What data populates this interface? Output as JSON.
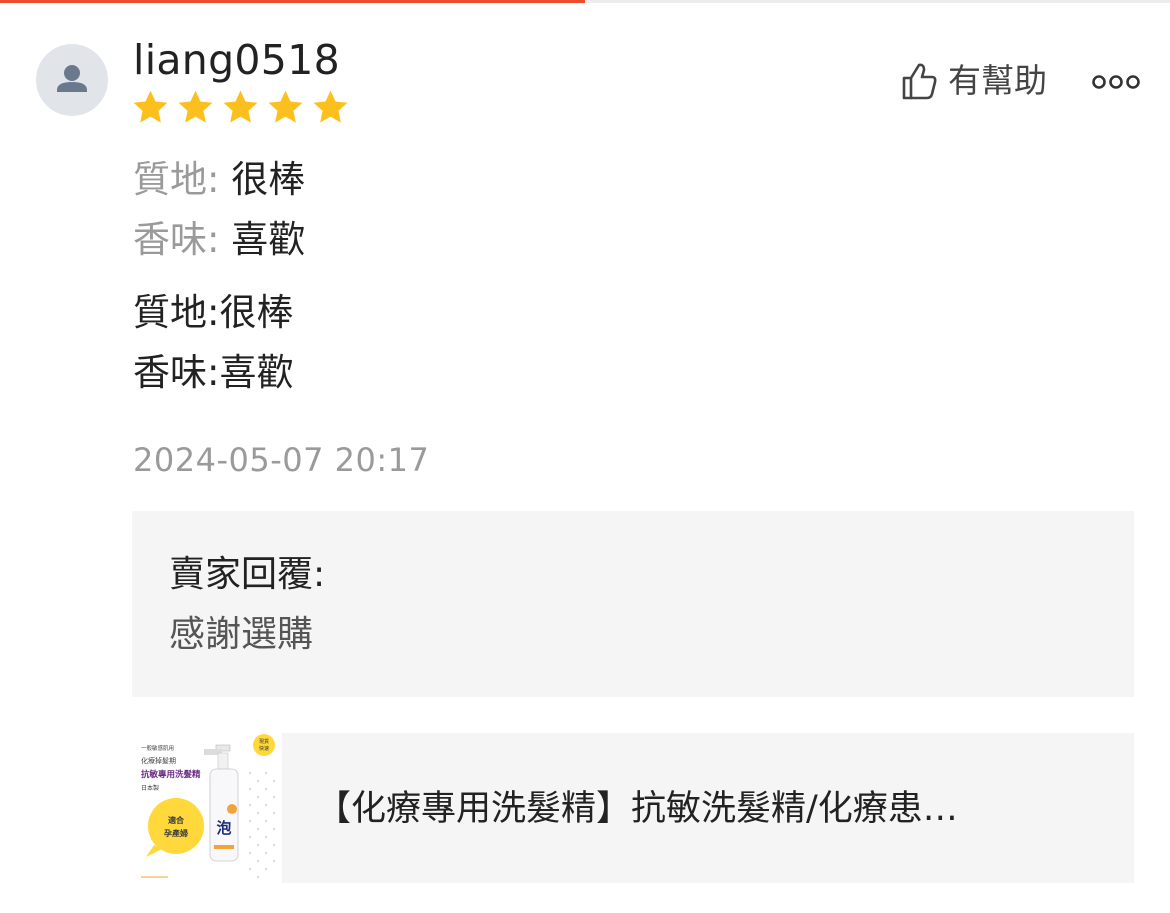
{
  "top_progress": {
    "fraction": 0.5,
    "color": "#ee4d2d"
  },
  "review": {
    "username": "liang0518",
    "rating": 5,
    "rating_max": 5,
    "star_color": "#fcc01e",
    "attributes": [
      {
        "key": "質地: ",
        "value": "很棒"
      },
      {
        "key": "香味: ",
        "value": "喜歡"
      }
    ],
    "body_lines": [
      "質地:很棒",
      "香味:喜歡"
    ],
    "timestamp": "2024-05-07 20:17",
    "helpful_label": "有幫助",
    "helpful_icon": "thumbs-up-icon",
    "more_icon": "more-options-icon"
  },
  "seller_reply": {
    "title": "賣家回覆:",
    "text": "感謝選購"
  },
  "product": {
    "title": "【化療專用洗髮精】抗敏洗髮精/化療患…",
    "thumbnail": {
      "line1": "一般敏感肌用",
      "line2": "化療掉髮期",
      "line3": "抗敏專用洗髮精",
      "line4": "日本製",
      "badge": "適合孕產婦",
      "bottle_char": "泡",
      "corner_tag": "現貨快速"
    }
  }
}
